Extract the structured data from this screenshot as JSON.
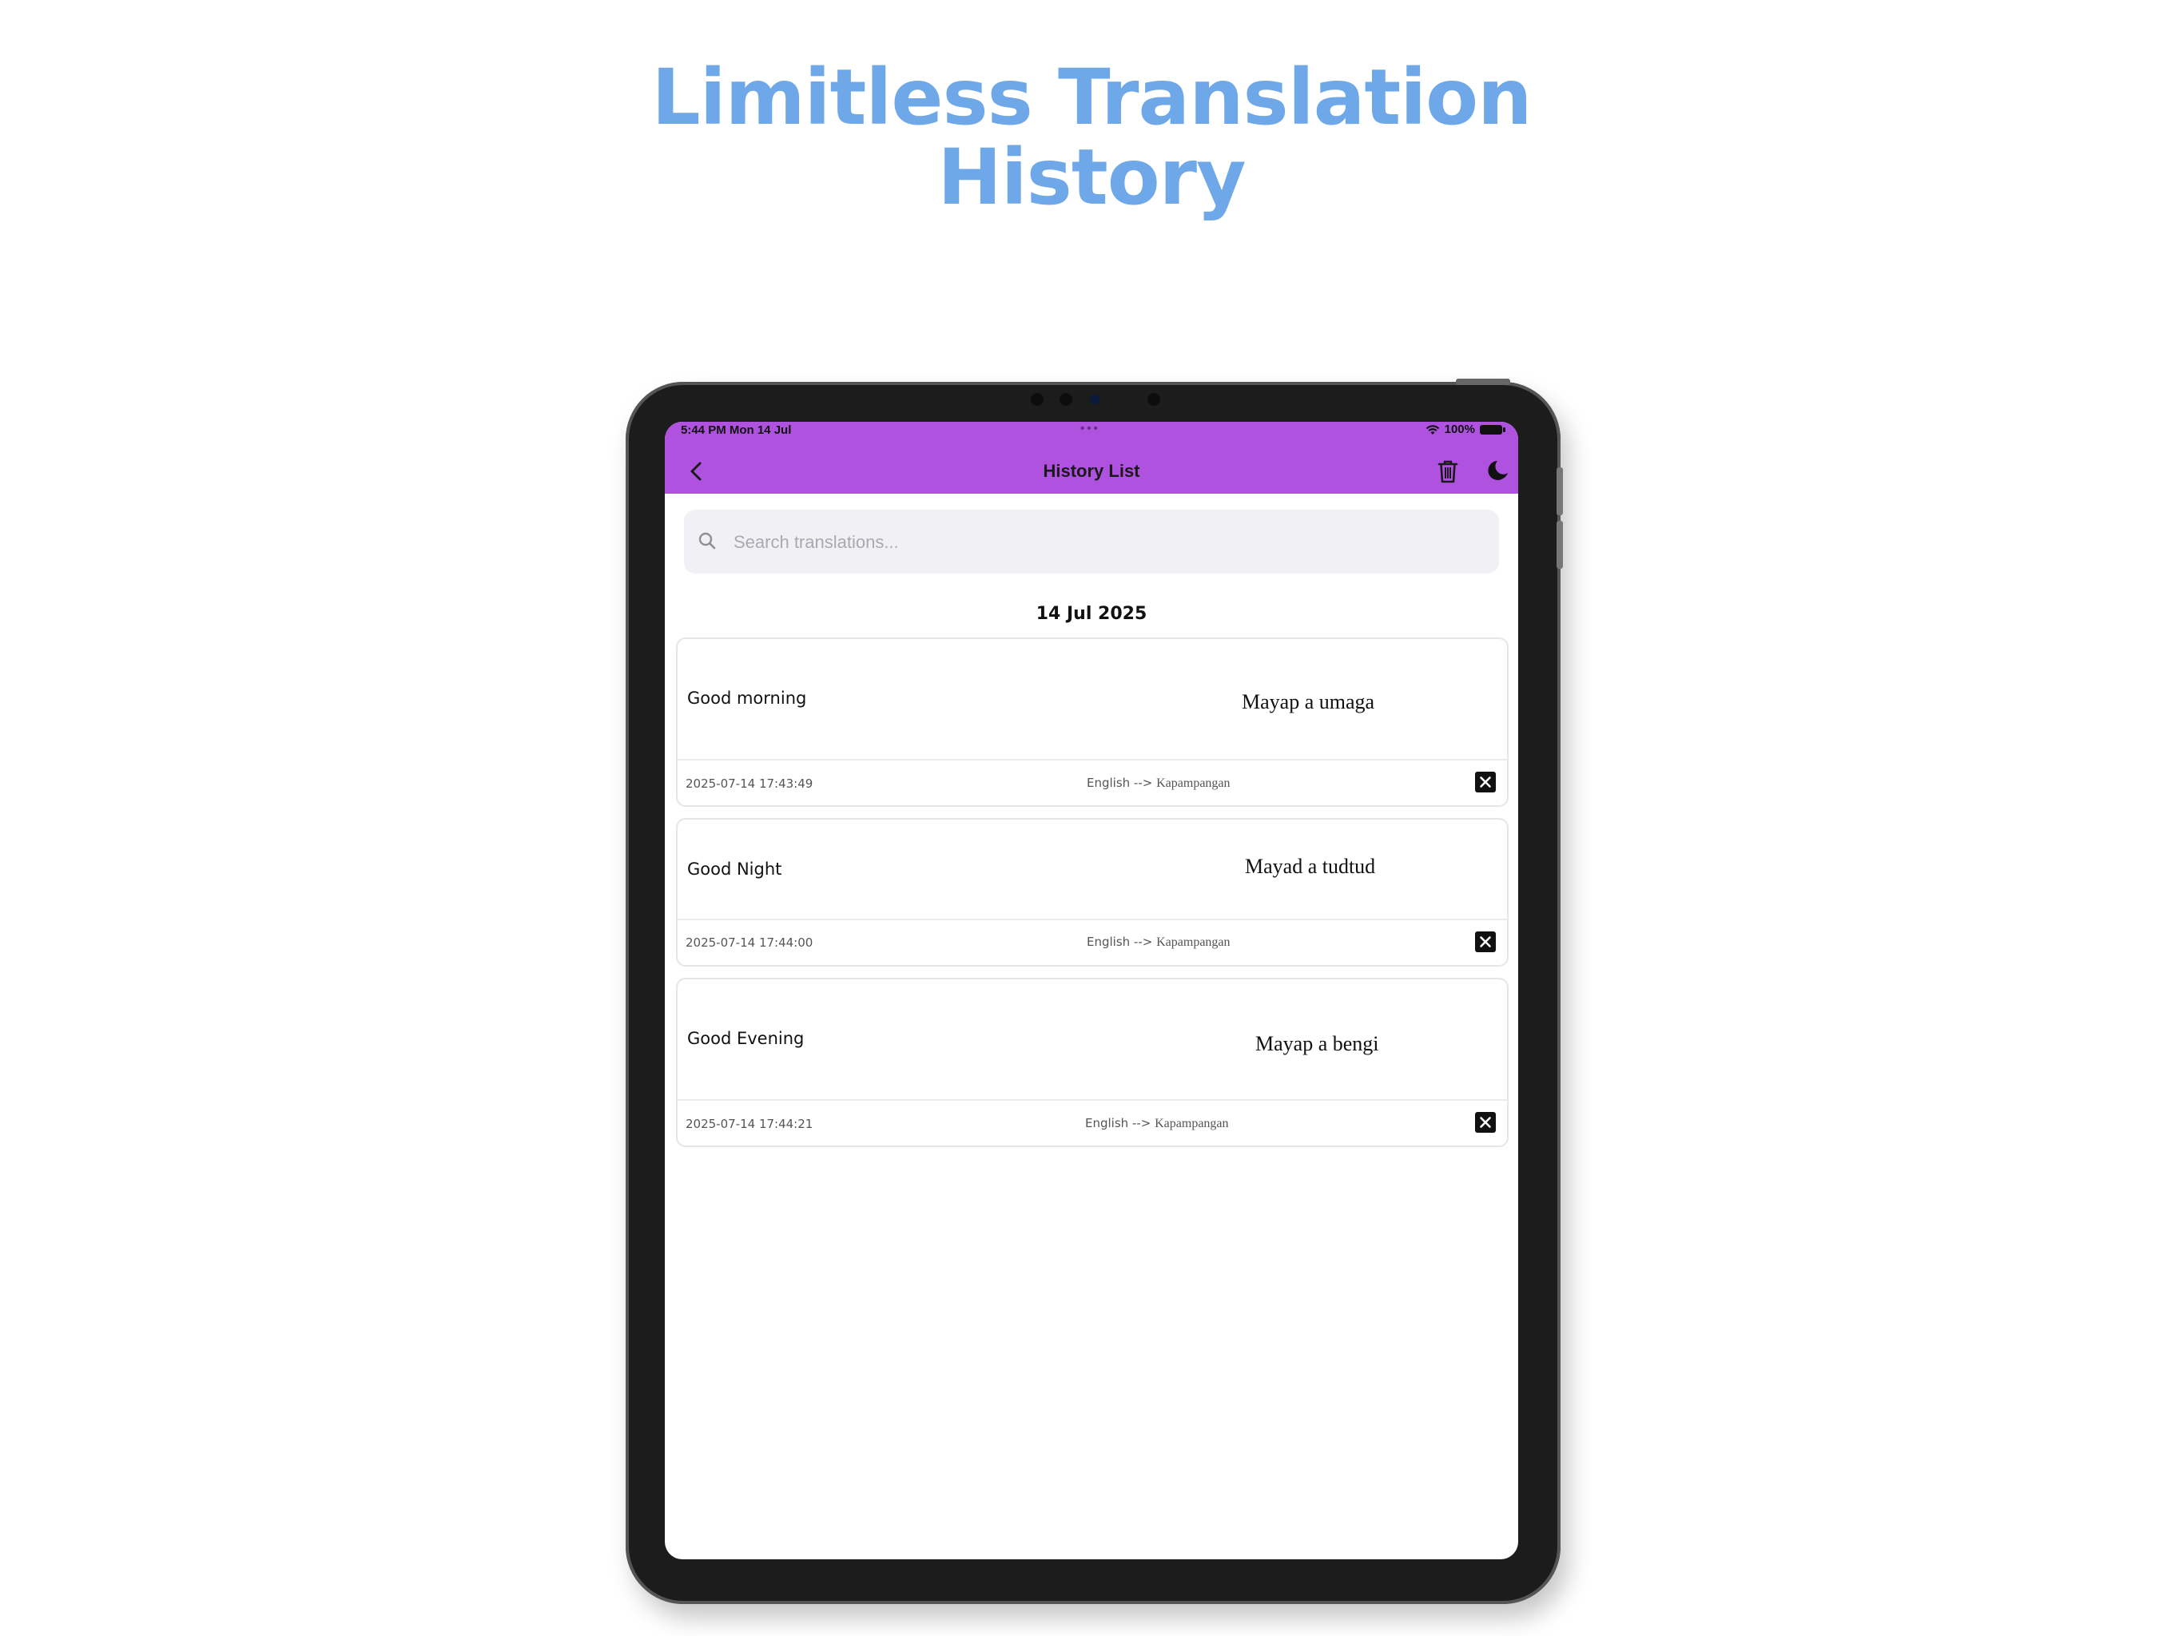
{
  "headline": {
    "line1": "Limitless Translation",
    "line2": "History"
  },
  "status_bar": {
    "time": "5:44 PM   Mon 14 Jul",
    "battery": "100%"
  },
  "app_bar": {
    "title": "History List"
  },
  "search": {
    "placeholder": "Search translations..."
  },
  "date_group": "14 Jul 2025",
  "entries": [
    {
      "source": "Good morning",
      "target": "Mayap a umaga",
      "timestamp": "2025-07-14 17:43:49",
      "from_lang": "English -->",
      "to_lang": "Kapampangan"
    },
    {
      "source": "Good Night",
      "target": "Mayad a tudtud",
      "timestamp": "2025-07-14 17:44:00",
      "from_lang": "English -->",
      "to_lang": "Kapampangan"
    },
    {
      "source": "Good Evening",
      "target": "Mayap a bengi",
      "timestamp": "2025-07-14 17:44:21",
      "from_lang": "English -->",
      "to_lang": "Kapampangan"
    }
  ],
  "colors": {
    "headline": "#6fa8e8",
    "app_bar": "#b052e0",
    "device_frame": "#1c1c1c"
  },
  "icons": {
    "back": "chevron-left-icon",
    "trash": "trash-icon",
    "theme": "moon-icon",
    "search": "search-icon",
    "delete": "close-icon"
  }
}
